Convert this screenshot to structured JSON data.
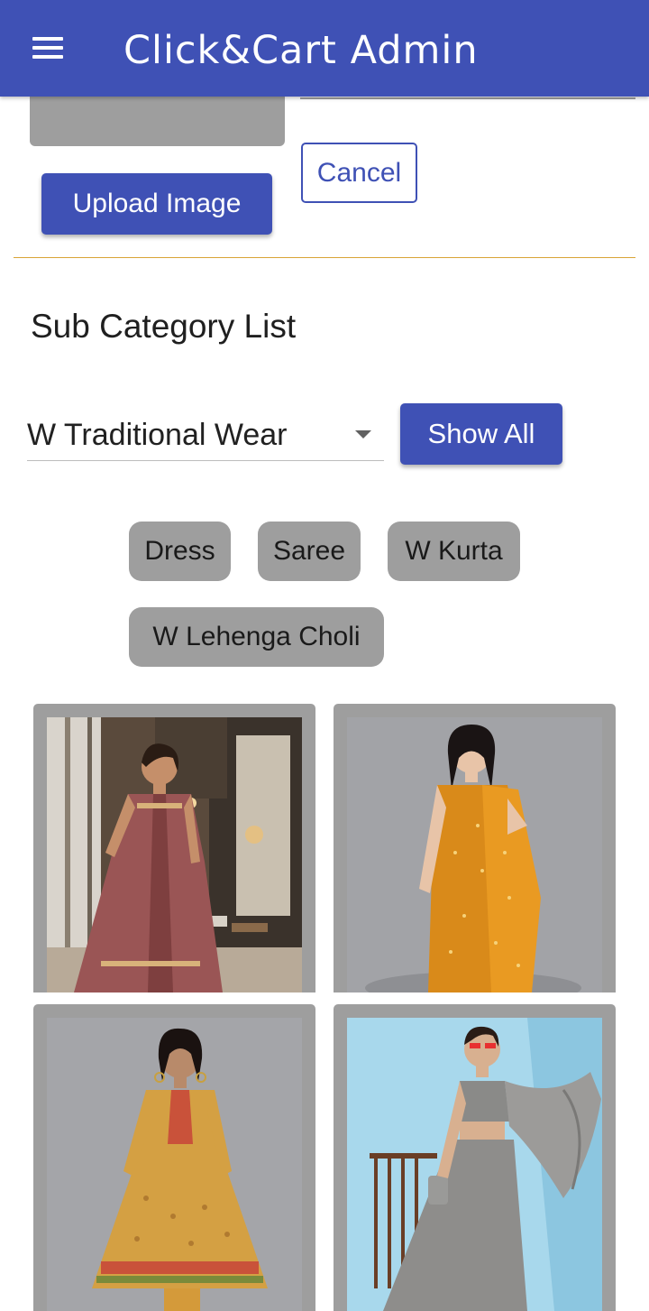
{
  "app_bar": {
    "title": "Click&Cart Admin",
    "menu_icon": "hamburger-menu-icon",
    "color": "#3f51b5"
  },
  "form": {
    "upload_label": "Upload Image",
    "cancel_label": "Cancel"
  },
  "section": {
    "title": "Sub Category List"
  },
  "filter": {
    "selected": "W Traditional Wear",
    "show_all_label": "Show All"
  },
  "chips": [
    "Dress",
    "Saree",
    "W Kurta",
    "W Lehenga Choli"
  ],
  "products": [
    {
      "name": "rose anarkali kurta",
      "background": "boutique interior"
    },
    {
      "name": "mustard draped saree",
      "background": "grey studio"
    },
    {
      "name": "printed ochre anarkali kurta",
      "background": "grey studio"
    },
    {
      "name": "grey lehenga choli",
      "background": "sky blue studio"
    }
  ],
  "colors": {
    "primary": "#3f51b5",
    "chip": "#9e9e9e",
    "divider": "#d9a437"
  }
}
